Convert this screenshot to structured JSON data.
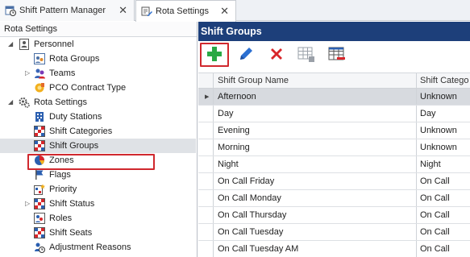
{
  "tabs": [
    {
      "label": "Shift Pattern Manager",
      "icon": "calendar-clock-icon"
    },
    {
      "label": "Rota Settings",
      "icon": "edit-settings-icon"
    }
  ],
  "left_panel": {
    "header": "Rota Settings",
    "tree": [
      {
        "label": "Personnel",
        "icon": "personnel-icon",
        "expander": "expanded"
      },
      {
        "label": "Rota Groups",
        "icon": "rota-groups-icon"
      },
      {
        "label": "Teams",
        "icon": "teams-icon",
        "expander": "collapsed"
      },
      {
        "label": "PCO Contract Type",
        "icon": "pco-contract-icon"
      },
      {
        "label": "Rota Settings",
        "icon": "gear-icon",
        "expander": "expanded"
      },
      {
        "label": "Duty Stations",
        "icon": "building-icon"
      },
      {
        "label": "Shift Categories",
        "icon": "grid-icon"
      },
      {
        "label": "Shift Groups",
        "icon": "grid-icon",
        "selected": true
      },
      {
        "label": "Zones",
        "icon": "pie-icon"
      },
      {
        "label": "Flags",
        "icon": "flag-icon"
      },
      {
        "label": "Priority",
        "icon": "priority-icon"
      },
      {
        "label": "Shift Status",
        "icon": "grid-icon",
        "expander": "collapsed"
      },
      {
        "label": "Roles",
        "icon": "roles-icon"
      },
      {
        "label": "Shift Seats",
        "icon": "grid-icon"
      },
      {
        "label": "Adjustment Reasons",
        "icon": "clock-person-icon"
      }
    ]
  },
  "right_panel": {
    "title": "Shift Groups",
    "toolbar": [
      {
        "name": "add-button",
        "icon": "plus-icon",
        "color": "#2aa845"
      },
      {
        "name": "edit-button",
        "icon": "pencil-icon",
        "color": "#2b6fd1"
      },
      {
        "name": "delete-button",
        "icon": "x-icon",
        "color": "#d8262a"
      },
      {
        "name": "add-row-button",
        "icon": "table-add-icon"
      },
      {
        "name": "remove-row-button",
        "icon": "table-remove-icon"
      }
    ],
    "columns": [
      "Shift Group Name",
      "Shift Catego"
    ],
    "rows": [
      {
        "name": "Afternoon",
        "category": "Unknown",
        "current": true
      },
      {
        "name": "Day",
        "category": "Day"
      },
      {
        "name": "Evening",
        "category": "Unknown"
      },
      {
        "name": "Morning",
        "category": "Unknown"
      },
      {
        "name": "Night",
        "category": "Night"
      },
      {
        "name": "On Call Friday",
        "category": "On Call"
      },
      {
        "name": "On Call Monday",
        "category": "On Call"
      },
      {
        "name": "On Call Thursday",
        "category": "On Call"
      },
      {
        "name": "On Call Tuesday",
        "category": "On Call"
      },
      {
        "name": "On Call Tuesday AM",
        "category": "On Call"
      }
    ]
  },
  "colors": {
    "header_bg": "#1d3f7a",
    "highlight": "#d0282e",
    "selection": "#dfe2e6"
  }
}
